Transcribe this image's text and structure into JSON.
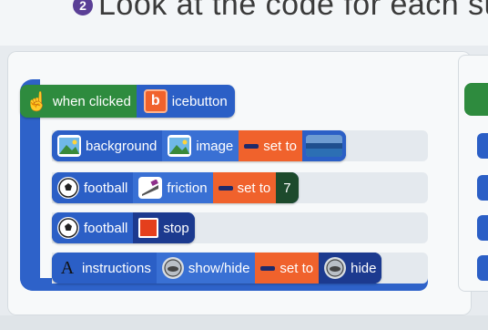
{
  "header": {
    "step_number": "2",
    "title": "Look at the code for each surface:"
  },
  "event_block": {
    "label": "when clicked",
    "key_letter": "b",
    "target": "icebutton"
  },
  "rows": [
    {
      "object": "background",
      "property": "image",
      "operator": "set to",
      "value_kind": "image-thumbnail"
    },
    {
      "object": "football",
      "property": "friction",
      "operator": "set to",
      "value": "7"
    },
    {
      "object": "football",
      "action": "stop"
    },
    {
      "object": "instructions",
      "property": "show/hide",
      "operator": "set to",
      "value": "hide"
    }
  ],
  "colors": {
    "block_blue": "#2b5fc6",
    "event_green": "#2e8b3e",
    "operator_orange": "#f0622c",
    "value_dark_green": "#1d4a2c"
  }
}
